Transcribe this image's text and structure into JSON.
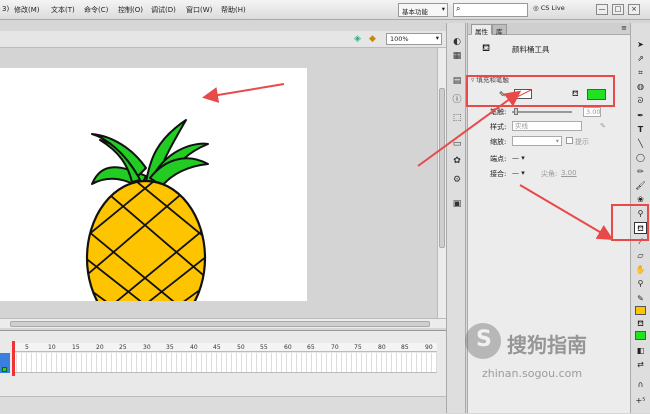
{
  "menubar": {
    "items": [
      "3)",
      "修改(M)",
      "文本(T)",
      "命令(C)",
      "控制(O)",
      "调试(D)",
      "窗口(W)",
      "帮助(H)"
    ],
    "workspace": "基本功能",
    "search_placeholder": "",
    "cslive": "CS Live",
    "window_buttons": [
      "—",
      "□",
      "×"
    ]
  },
  "stage": {
    "zoom": "100%"
  },
  "timeline": {
    "frame_numbers": [
      "5",
      "10",
      "15",
      "20",
      "25",
      "30",
      "35",
      "40",
      "45",
      "50",
      "55",
      "60",
      "65",
      "70",
      "75",
      "80",
      "85",
      "90"
    ]
  },
  "properties": {
    "tabs": [
      "属性",
      "库"
    ],
    "tool_title": "颜料桶工具",
    "section_header": "填充和笔触",
    "stroke_label": "笔触:",
    "stroke_value": "3.00",
    "style_label": "样式:",
    "style_value": "实线",
    "scale_label": "缩放:",
    "hint_label": "提示",
    "cap_label": "端点:",
    "join_label": "接合:",
    "miter_label": "尖角:",
    "miter_value": "3.00"
  },
  "colors": {
    "fill": "#22e022",
    "annotation": "#e84a4a",
    "pineapple_body": "#ffc400",
    "pineapple_leaves": "#22cc22"
  },
  "watermark": {
    "brand": "搜狗指南",
    "url": "zhinan.sogou.com"
  }
}
